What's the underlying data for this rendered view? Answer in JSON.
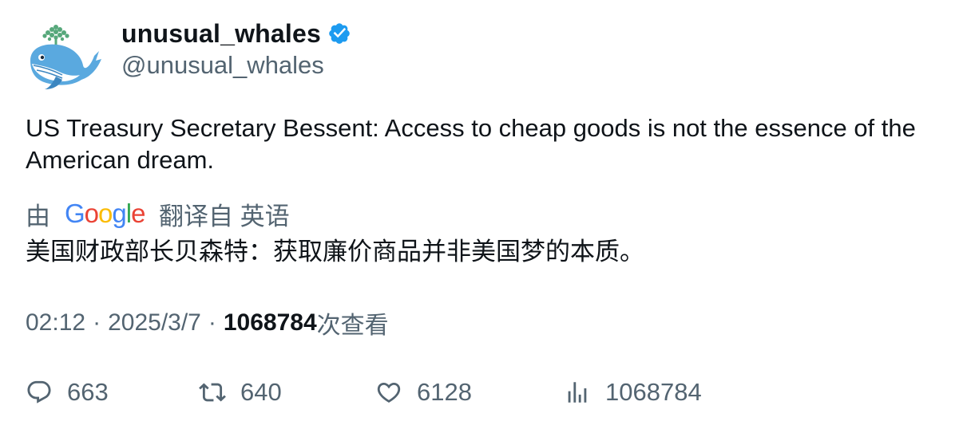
{
  "author": {
    "display_name": "unusual_whales",
    "handle": "@unusual_whales",
    "verified": true,
    "avatar_icon": "whale-logo-icon",
    "verified_color": "#1d9bf0"
  },
  "tweet": {
    "text": "US Treasury Secretary Bessent: Access to cheap goods is not the essence of the American dream."
  },
  "translation": {
    "by_label": "由",
    "provider": "Google",
    "from_label": "翻译自 英语",
    "text": "美国财政部长贝森特：获取廉价商品并非美国梦的本质。"
  },
  "meta": {
    "time": "02:12",
    "separator": "·",
    "date": "2025/3/7",
    "views_count": "1068784",
    "views_label": "次查看"
  },
  "actions": {
    "replies": "663",
    "retweets": "640",
    "likes": "6128",
    "views": "1068784"
  },
  "colors": {
    "text_primary": "#0f1419",
    "text_secondary": "#536471",
    "google_blue": "#4285F4",
    "google_red": "#EA4335",
    "google_yellow": "#FBBC05",
    "google_green": "#34A853"
  }
}
